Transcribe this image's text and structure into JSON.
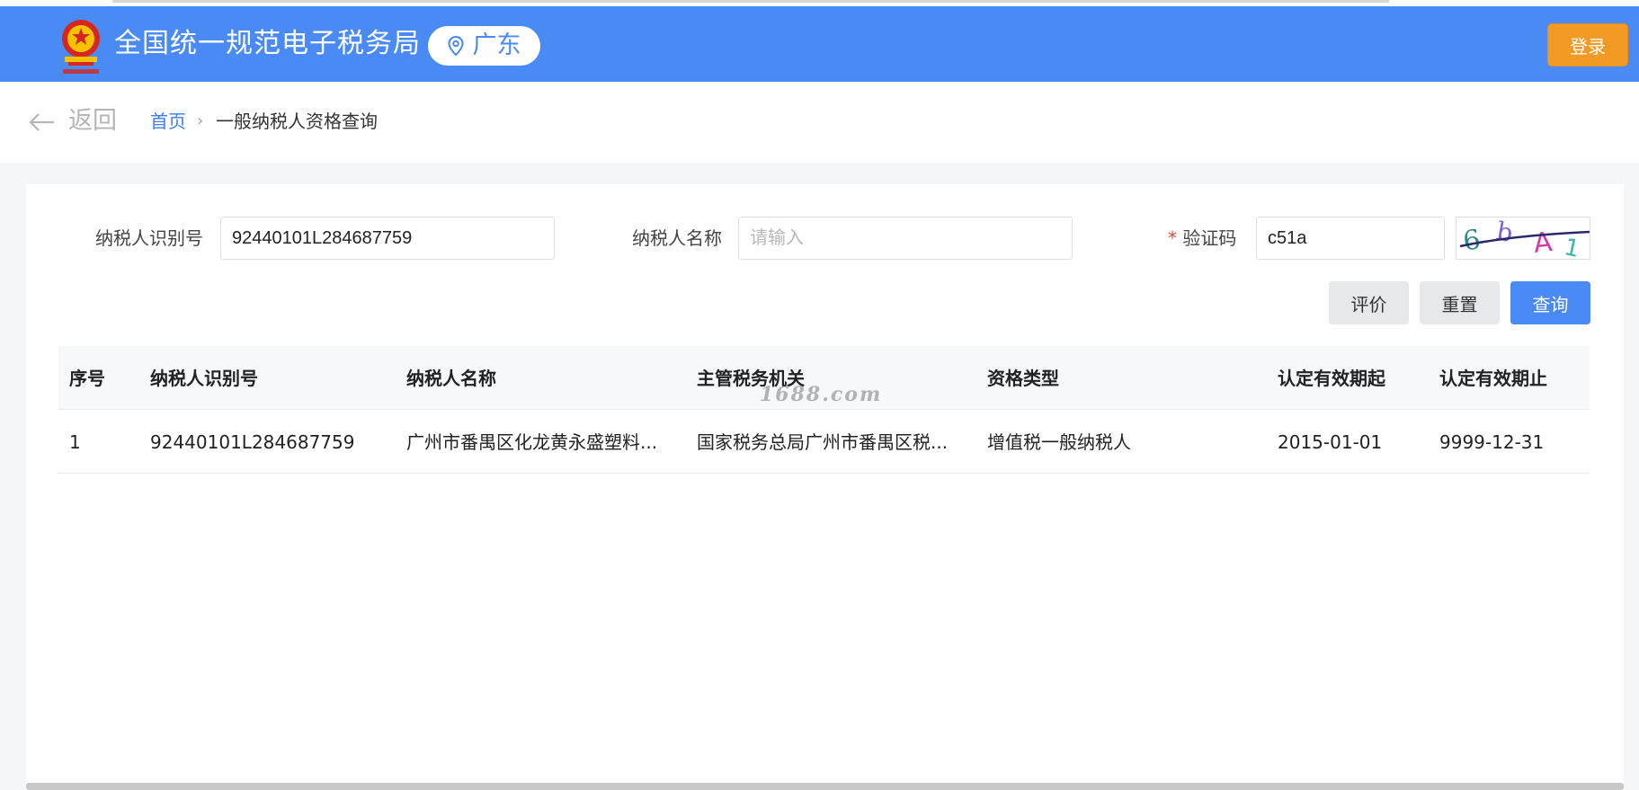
{
  "header": {
    "site_title": "全国统一规范电子税务局",
    "region": "广东",
    "login_label": "登录",
    "brand_color": "#4a8af4",
    "login_color": "#f39a25"
  },
  "breadcrumb": {
    "back_label": "返回",
    "home_label": "首页",
    "separator": "›",
    "current_label": "一般纳税人资格查询"
  },
  "form": {
    "taxpayer_id_label": "纳税人识别号",
    "taxpayer_id_value": "92440101L284687759",
    "taxpayer_name_label": "纳税人名称",
    "taxpayer_name_placeholder": "请输入",
    "captcha_required_mark": "*",
    "captcha_label": "验证码",
    "captcha_value": "c51a",
    "captcha_image_text": "6bA1"
  },
  "actions": {
    "evaluate_label": "评价",
    "reset_label": "重置",
    "query_label": "查询"
  },
  "table": {
    "columns": [
      "序号",
      "纳税人识别号",
      "纳税人名称",
      "主管税务机关",
      "资格类型",
      "认定有效期起",
      "认定有效期止"
    ],
    "rows": [
      [
        "1",
        "92440101L284687759",
        "广州市番禺区化龙黄永盛塑料...",
        "国家税务总局广州市番禺区税...",
        "增值税一般纳税人",
        "2015-01-01",
        "9999-12-31"
      ]
    ]
  },
  "watermark": "1688.com"
}
